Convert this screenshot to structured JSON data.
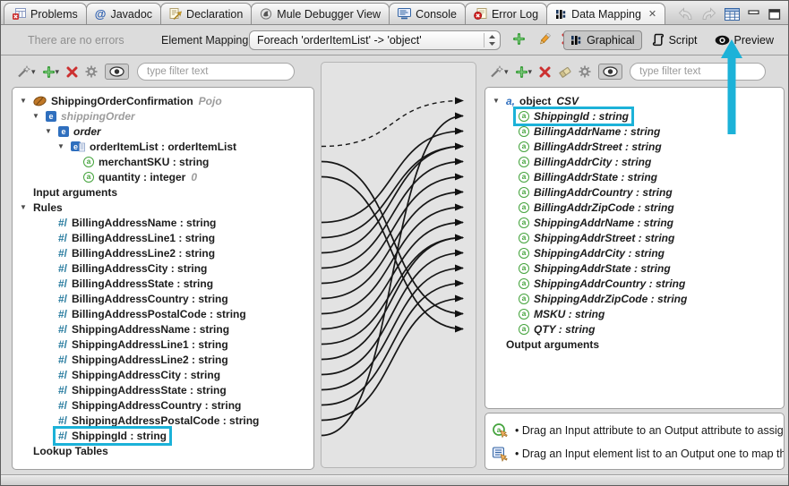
{
  "tab_bar": {
    "tabs": [
      {
        "label": "Problems",
        "icon": "problems-icon",
        "active": false
      },
      {
        "label": "Javadoc",
        "icon": "javadoc-icon",
        "active": false
      },
      {
        "label": "Declaration",
        "icon": "declaration-icon",
        "active": false
      },
      {
        "label": "Mule Debugger View",
        "icon": "mule-debugger-icon",
        "active": false
      },
      {
        "label": "Console",
        "icon": "console-icon",
        "active": false
      },
      {
        "label": "Error Log",
        "icon": "error-log-icon",
        "active": false
      },
      {
        "label": "Data Mapping",
        "icon": "data-mapping-icon",
        "active": true,
        "close": "✕"
      }
    ],
    "window_icons": [
      "back-icon",
      "forward-icon",
      "view-menu-icon",
      "minimize-icon",
      "maximize-icon"
    ]
  },
  "toolbar": {
    "status": "There are no errors",
    "element_mapping_label": "Element Mapping",
    "foreach_value": "Foreach 'orderItemList' -> 'object'",
    "actions": [
      {
        "icon": "add-icon",
        "name": "add-mapping-button"
      },
      {
        "icon": "edit-icon",
        "name": "edit-mapping-button"
      },
      {
        "icon": "delete-icon",
        "name": "delete-mapping-button"
      }
    ],
    "modes": [
      {
        "label": "Graphical",
        "icon": "graphical-icon",
        "active": true
      },
      {
        "label": "Script",
        "icon": "script-icon",
        "active": false
      },
      {
        "label": "Preview",
        "icon": "preview-icon",
        "active": false
      }
    ]
  },
  "left_panel": {
    "toolbar": [
      {
        "icon": "wand-icon",
        "caret": true,
        "name": "mapping-wizard-button"
      },
      {
        "icon": "add-icon",
        "caret": true,
        "name": "add-field-button"
      },
      {
        "icon": "delete-icon",
        "name": "delete-field-button"
      },
      {
        "icon": "gear-icon",
        "name": "properties-button"
      },
      {
        "icon": "eye-icon",
        "pressed": true,
        "name": "toggle-visibility-button"
      }
    ],
    "filter_placeholder": "type filter text",
    "tree": [
      {
        "arrow": true,
        "icon": "bean-icon",
        "text": "ShippingOrderConfirmation",
        "suffix": "Pojo",
        "suffix_cls": "gi",
        "cls": "b",
        "indent": 0
      },
      {
        "arrow": true,
        "icon": "element-icon",
        "text": "shippingOrder",
        "cls": "gi",
        "indent": 1
      },
      {
        "arrow": true,
        "icon": "element-icon",
        "text": "order",
        "cls": "bi",
        "indent": 2
      },
      {
        "arrow": true,
        "icon": "element-list-icon",
        "text": "orderItemList : orderItemList",
        "cls": "b",
        "indent": 3
      },
      {
        "icon": "attribute-icon",
        "text": "merchantSKU : string",
        "cls": "b",
        "indent": 4
      },
      {
        "icon": "attribute-icon",
        "text": "quantity : integer",
        "suffix": "0",
        "suffix_cls": "gi",
        "cls": "b",
        "indent": 4
      },
      {
        "text": "Input arguments",
        "cls": "b",
        "indent": 0,
        "section": true
      },
      {
        "arrow": true,
        "text": "Rules",
        "cls": "b",
        "indent": 0,
        "section": true
      },
      {
        "icon": "rule-icon",
        "text": "BillingAddressName : string",
        "cls": "b",
        "indent": 2
      },
      {
        "icon": "rule-icon",
        "text": "BillingAddressLine1 : string",
        "cls": "b",
        "indent": 2
      },
      {
        "icon": "rule-icon",
        "text": "BillingAddressLine2 : string",
        "cls": "b",
        "indent": 2
      },
      {
        "icon": "rule-icon",
        "text": "BillingAddressCity : string",
        "cls": "b",
        "indent": 2
      },
      {
        "icon": "rule-icon",
        "text": "BillingAddressState : string",
        "cls": "b",
        "indent": 2
      },
      {
        "icon": "rule-icon",
        "text": "BillingAddressCountry : string",
        "cls": "b",
        "indent": 2
      },
      {
        "icon": "rule-icon",
        "text": "BillingAddressPostalCode : string",
        "cls": "b",
        "indent": 2
      },
      {
        "icon": "rule-icon",
        "text": "ShippingAddressName : string",
        "cls": "b",
        "indent": 2
      },
      {
        "icon": "rule-icon",
        "text": "ShippingAddressLine1 : string",
        "cls": "b",
        "indent": 2
      },
      {
        "icon": "rule-icon",
        "text": "ShippingAddressLine2 : string",
        "cls": "b",
        "indent": 2
      },
      {
        "icon": "rule-icon",
        "text": "ShippingAddressCity : string",
        "cls": "b",
        "indent": 2
      },
      {
        "icon": "rule-icon",
        "text": "ShippingAddressState : string",
        "cls": "b",
        "indent": 2
      },
      {
        "icon": "rule-icon",
        "text": "ShippingAddressCountry : string",
        "cls": "b",
        "indent": 2
      },
      {
        "icon": "rule-icon",
        "text": "ShippingAddressPostalCode : string",
        "cls": "b",
        "indent": 2
      },
      {
        "icon": "rule-icon",
        "text": "ShippingId : string",
        "cls": "b",
        "indent": 2,
        "highlight": true
      },
      {
        "text": "Lookup Tables",
        "cls": "b",
        "indent": 0,
        "section": true
      }
    ]
  },
  "right_panel": {
    "toolbar": [
      {
        "icon": "wand-icon",
        "caret": true,
        "name": "mapping-wizard-button"
      },
      {
        "icon": "add-icon",
        "caret": true,
        "name": "add-field-button"
      },
      {
        "icon": "delete-icon",
        "name": "delete-field-button"
      },
      {
        "icon": "eraser-icon",
        "name": "clear-button"
      },
      {
        "icon": "gear-icon",
        "name": "properties-button"
      },
      {
        "icon": "eye-icon",
        "pressed": true,
        "name": "toggle-visibility-button"
      }
    ],
    "filter_placeholder": "type filter text",
    "tree": [
      {
        "arrow": true,
        "icon": "csv-object-icon",
        "text": "object",
        "suffix": "CSV",
        "suffix_cls": "i",
        "cls": "b",
        "indent": 0
      },
      {
        "icon": "attribute-icon",
        "text": "ShippingId : string",
        "cls": "bi",
        "indent": 1,
        "highlight": true
      },
      {
        "icon": "attribute-icon",
        "text": "BillingAddrName : string",
        "cls": "bi",
        "indent": 1
      },
      {
        "icon": "attribute-icon",
        "text": "BillingAddrStreet : string",
        "cls": "bi",
        "indent": 1
      },
      {
        "icon": "attribute-icon",
        "text": "BillingAddrCity : string",
        "cls": "bi",
        "indent": 1
      },
      {
        "icon": "attribute-icon",
        "text": "BillingAddrState : string",
        "cls": "bi",
        "indent": 1
      },
      {
        "icon": "attribute-icon",
        "text": "BillingAddrCountry : string",
        "cls": "bi",
        "indent": 1
      },
      {
        "icon": "attribute-icon",
        "text": "BillingAddrZipCode : string",
        "cls": "bi",
        "indent": 1
      },
      {
        "icon": "attribute-icon",
        "text": "ShippingAddrName : string",
        "cls": "bi",
        "indent": 1
      },
      {
        "icon": "attribute-icon",
        "text": "ShippingAddrStreet : string",
        "cls": "bi",
        "indent": 1
      },
      {
        "icon": "attribute-icon",
        "text": "ShippingAddrCity : string",
        "cls": "bi",
        "indent": 1
      },
      {
        "icon": "attribute-icon",
        "text": "ShippingAddrState : string",
        "cls": "bi",
        "indent": 1
      },
      {
        "icon": "attribute-icon",
        "text": "ShippingAddrCountry : string",
        "cls": "bi",
        "indent": 1
      },
      {
        "icon": "attribute-icon",
        "text": "ShippingAddrZipCode : string",
        "cls": "bi",
        "indent": 1
      },
      {
        "icon": "attribute-icon",
        "text": "MSKU : string",
        "cls": "bi",
        "indent": 1
      },
      {
        "icon": "attribute-icon",
        "text": "QTY : string",
        "cls": "bi",
        "indent": 1
      },
      {
        "text": "Output arguments",
        "cls": "b",
        "indent": 0,
        "section": true
      }
    ]
  },
  "hints": [
    {
      "icon": "drag-attribute-icon",
      "text": "• Drag an Input attribute to an Output attribute to assig"
    },
    {
      "icon": "drag-element-list-icon",
      "text": "• Drag an Input element list to an Output one to map th"
    }
  ],
  "mappings": {
    "dashed": [
      [
        3,
        0
      ]
    ],
    "solid": [
      [
        4,
        14
      ],
      [
        5,
        15
      ],
      [
        8,
        2
      ],
      [
        9,
        3
      ],
      [
        10,
        3
      ],
      [
        11,
        4
      ],
      [
        12,
        5
      ],
      [
        13,
        6
      ],
      [
        14,
        7
      ],
      [
        15,
        8
      ],
      [
        16,
        9
      ],
      [
        17,
        9
      ],
      [
        18,
        10
      ],
      [
        19,
        11
      ],
      [
        20,
        12
      ],
      [
        21,
        13
      ],
      [
        22,
        1
      ]
    ]
  },
  "annotation": {
    "highlight_color": "#1cb2d8"
  }
}
